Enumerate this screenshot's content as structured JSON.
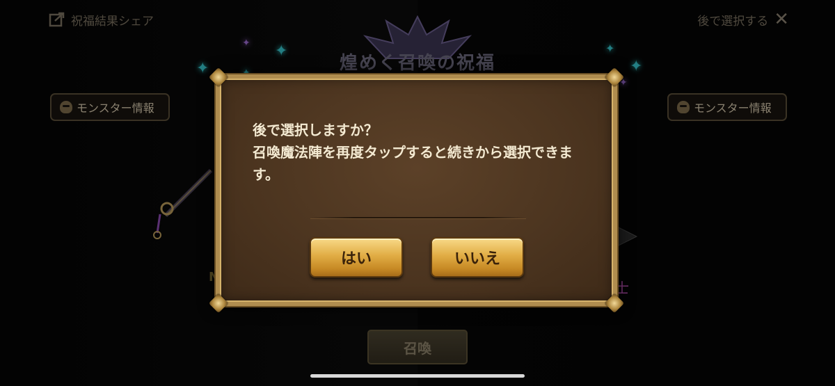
{
  "header": {
    "share_label": "祝福結果シェア",
    "share_icon": "share-icon",
    "later_label": "後で選択する",
    "close_icon": "close-icon"
  },
  "banner": {
    "title": "煌めく召喚の祝福"
  },
  "monster_info": {
    "left_label": "モンスター情報",
    "right_label": "モンスター情報",
    "icon": "skull-icon"
  },
  "summon_button": {
    "label": "召喚"
  },
  "dialog": {
    "message": "後で選択しますか？\n召喚魔法陣を再度タップすると続きから選択できます。",
    "yes_label": "はい",
    "no_label": "いいえ"
  },
  "colors": {
    "dialog_border": "#b08d4f",
    "dialog_bg": "#4b341f",
    "button_gold": "#e1ad45",
    "accent_sparkle": "#37c2c9"
  }
}
